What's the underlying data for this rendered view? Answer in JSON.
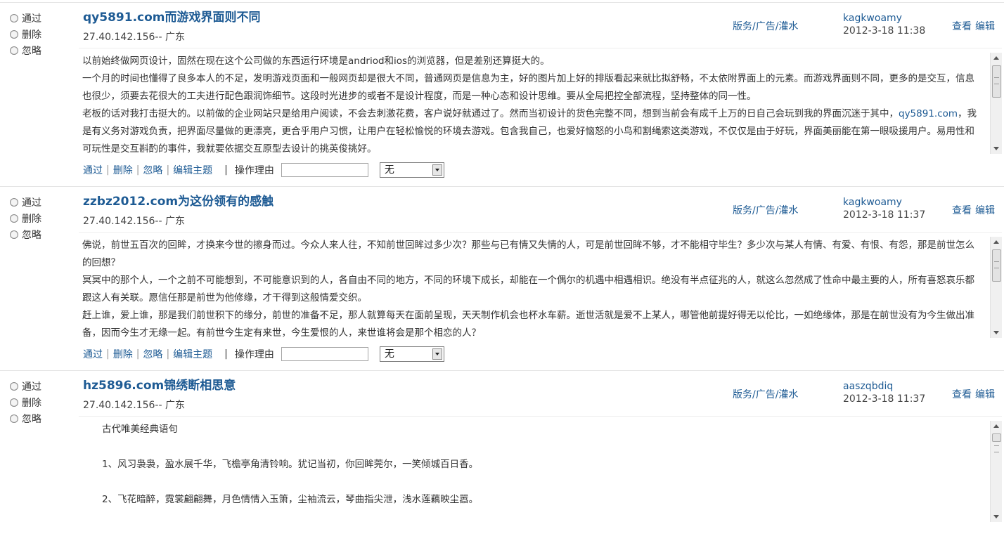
{
  "actions": {
    "approve": "通过",
    "delete": "删除",
    "ignore": "忽略",
    "edit_topic": "编辑主题",
    "reason_label": "操作理由",
    "reason_select": "无",
    "separator": "|"
  },
  "links": {
    "view": "查看",
    "edit": "编辑"
  },
  "posts": [
    {
      "title": "qy5891.com而游戏界面则不同",
      "ip": "27.40.142.156-- 广东",
      "category": "版务/广告/灌水",
      "author": "kagkwoamy",
      "date": "2012-3-18 11:38",
      "content": {
        "p1": "以前始终做网页设计，固然在现在这个公司做的东西运行环境是andriod和ios的浏览器，但是差别还算挺大的。",
        "p2": "一个月的时间也懂得了良多本人的不足，发明游戏页面和一般网页却是很大不同，普通网页是信息为主，好的图片加上好的排版看起来就比拟舒畅，不太依附界面上的元素。而游戏界面则不同，更多的是交互，信息也很少，须要去花很大的工夫进行配色跟润饰细节。这段时光进步的或者不是设计程度，而是一种心态和设计思维。要从全局把控全部流程，坚持整体的同一性。",
        "p3_a": "老板的话对我打击挺大的。以前做的企业网站只是给用户阅读，不会去刺激花费，客户说好就通过了。然而当初设计的货色完整不同，想到当前会有成千上万的日自己会玩到我的界面沉迷于其中，",
        "p3_link": "qy5891.com",
        "p3_b": "，我是有义务对游戏负责，把界面尽量做的更漂亮，更合乎用户习惯，让用户在轻松愉悦的环境去游戏。包含我自己，也爱好恼怒的小鸟和割绳索这类游戏，不仅仅是由于好玩，界面美丽能在第一眼吸援用户。易用性和可玩性是交互斟酌的事件，我就要依据交互原型去设计的挑英俊挑好。"
      }
    },
    {
      "title": "zzbz2012.com为这份领有的感触",
      "ip": "27.40.142.156-- 广东",
      "category": "版务/广告/灌水",
      "author": "kagkwoamy",
      "date": "2012-3-18 11:37",
      "content": {
        "p1": "佛说，前世五百次的回眸，才换来今世的擦身而过。今众人来人往，不知前世回眸过多少次？那些与已有情又失情的人，可是前世回眸不够，才不能相守毕生？多少次与某人有情、有爱、有恨、有怨，那是前世怎么的回想？",
        "p2": "冥冥中的那个人，一个之前不可能想到，不可能意识到的人，各自由不同的地方，不同的环境下成长，却能在一个偶尔的机遇中相遇相识。绝没有半点征兆的人，就这么忽然成了性命中最主要的人，所有喜怒哀乐都跟这人有关联。愿信任那是前世为他修缘，才干得到这般情爱交织。",
        "p3": "赶上谁，爱上谁，那是我们前世积下的缘分，前世的准备不足，那人就算每天在面前呈现，天天制作机会也杯水车薪。逝世活就是爱不上某人，哪管他前提好得无以伦比，一如绝缘体，那是在前世没有为今生做出准备，因而今生才无缘一起。有前世今生定有来世，今生爱恨的人，来世谁将会是那个相恋的人？"
      }
    },
    {
      "title": "hz5896.com锦绣断相思意",
      "ip": "27.40.142.156-- 广东",
      "category": "版务/广告/灌水",
      "author": "aaszqbdiq",
      "date": "2012-3-18 11:37",
      "content": {
        "p1": "古代唯美经典语句",
        "p2": "1、风习袅袅，盈水展千华，飞檐亭角清铃响。犹记当初，你回眸莞尔，一笑倾城百日香。",
        "p3": "2、飞花暗醉，霓裳翩翩舞，月色情情入玉箫，尘袖流云，琴曲指尖泄，浅水莲藕映尘嚣。"
      }
    }
  ]
}
